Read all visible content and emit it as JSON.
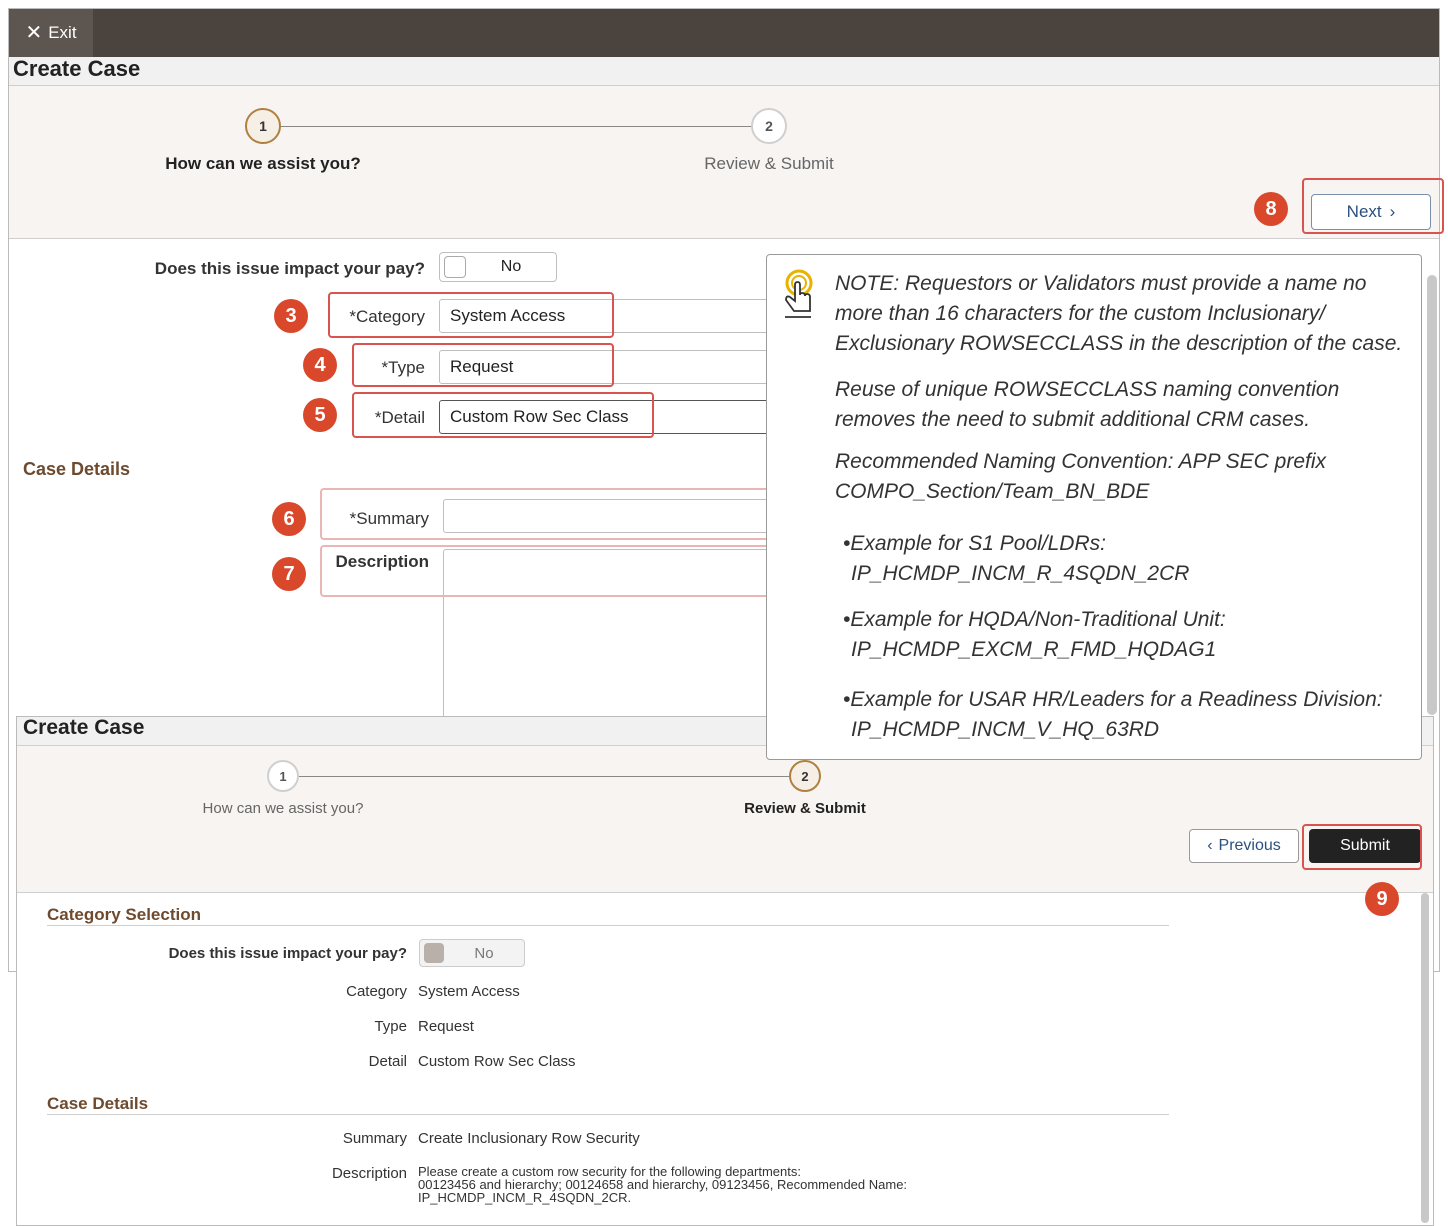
{
  "window1": {
    "exit_label": "Exit",
    "title": "Create Case",
    "steps": [
      {
        "number": "1",
        "label": "How can we assist you?",
        "state": "active"
      },
      {
        "number": "2",
        "label": "Review & Submit",
        "state": "inactive"
      }
    ],
    "next_label": "Next",
    "pay_question": "Does this issue impact your pay?",
    "pay_value": "No",
    "category_label": "*Category",
    "category_value": "System Access",
    "type_label": "*Type",
    "type_value": "Request",
    "detail_label": "*Detail",
    "detail_value": "Custom Row Sec Class",
    "case_details_header": "Case Details",
    "summary_label": "*Summary",
    "summary_value": "",
    "description_label": "Description",
    "description_value": ""
  },
  "badges": [
    "3",
    "4",
    "5",
    "6",
    "7",
    "8",
    "9"
  ],
  "note": {
    "icon": "touch-hand-icon",
    "paragraphs": [
      "NOTE: Requestors or Validators must provide a name no more than 16 characters for the custom Inclusionary/ Exclusionary ROWSECCLASS in the description of the case.",
      "Reuse of unique ROWSECCLASS naming convention removes the need to submit additional CRM cases.",
      "Recommended Naming Convention: APP SEC prefix COMPO_Section/Team_BN_BDE"
    ],
    "bullets": [
      {
        "line1": "Example for S1 Pool/LDRs:",
        "line2": "IP_HCMDP_INCM_R_4SQDN_2CR"
      },
      {
        "line1": "Example for HQDA/Non-Traditional Unit:",
        "line2": "IP_HCMDP_EXCM_R_FMD_HQDAG1"
      },
      {
        "line1": "Example for USAR HR/Leaders for a Readiness Division:",
        "line2": "IP_HCMDP_INCM_V_HQ_63RD"
      }
    ]
  },
  "window2": {
    "title": "Create Case",
    "steps": [
      {
        "number": "1",
        "label": "How can we assist you?",
        "state": "inactive"
      },
      {
        "number": "2",
        "label": "Review & Submit",
        "state": "active"
      }
    ],
    "previous_label": "Previous",
    "submit_label": "Submit",
    "category_selection_header": "Category Selection",
    "pay_question": "Does this issue impact your pay?",
    "pay_value": "No",
    "category_label": "Category",
    "category_value": "System Access",
    "type_label": "Type",
    "type_value": "Request",
    "detail_label": "Detail",
    "detail_value": "Custom Row Sec Class",
    "case_details_header": "Case Details",
    "summary_label": "Summary",
    "summary_value": "Create Inclusionary Row Security",
    "description_label": "Description",
    "description_lines": [
      "Please create a custom row security for the following departments:",
      "00123456 and hierarchy; 00124658 and hierarchy, 09123456, Recommended Name:",
      "IP_HCMDP_INCM_R_4SQDN_2CR."
    ]
  },
  "colors": {
    "topbar": "#4a433e",
    "accent_brown": "#6e4a2e",
    "callout_red": "#d9482b",
    "link_blue": "#2b5080"
  }
}
